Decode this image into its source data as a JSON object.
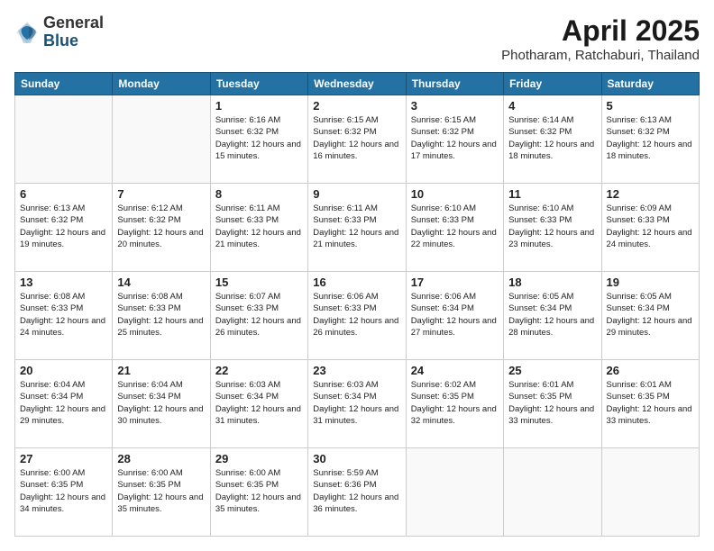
{
  "logo": {
    "general": "General",
    "blue": "Blue"
  },
  "title": {
    "month": "April 2025",
    "location": "Photharam, Ratchaburi, Thailand"
  },
  "weekdays": [
    "Sunday",
    "Monday",
    "Tuesday",
    "Wednesday",
    "Thursday",
    "Friday",
    "Saturday"
  ],
  "weeks": [
    [
      {
        "day": "",
        "info": ""
      },
      {
        "day": "",
        "info": ""
      },
      {
        "day": "1",
        "info": "Sunrise: 6:16 AM\nSunset: 6:32 PM\nDaylight: 12 hours\nand 15 minutes."
      },
      {
        "day": "2",
        "info": "Sunrise: 6:15 AM\nSunset: 6:32 PM\nDaylight: 12 hours\nand 16 minutes."
      },
      {
        "day": "3",
        "info": "Sunrise: 6:15 AM\nSunset: 6:32 PM\nDaylight: 12 hours\nand 17 minutes."
      },
      {
        "day": "4",
        "info": "Sunrise: 6:14 AM\nSunset: 6:32 PM\nDaylight: 12 hours\nand 18 minutes."
      },
      {
        "day": "5",
        "info": "Sunrise: 6:13 AM\nSunset: 6:32 PM\nDaylight: 12 hours\nand 18 minutes."
      }
    ],
    [
      {
        "day": "6",
        "info": "Sunrise: 6:13 AM\nSunset: 6:32 PM\nDaylight: 12 hours\nand 19 minutes."
      },
      {
        "day": "7",
        "info": "Sunrise: 6:12 AM\nSunset: 6:32 PM\nDaylight: 12 hours\nand 20 minutes."
      },
      {
        "day": "8",
        "info": "Sunrise: 6:11 AM\nSunset: 6:33 PM\nDaylight: 12 hours\nand 21 minutes."
      },
      {
        "day": "9",
        "info": "Sunrise: 6:11 AM\nSunset: 6:33 PM\nDaylight: 12 hours\nand 21 minutes."
      },
      {
        "day": "10",
        "info": "Sunrise: 6:10 AM\nSunset: 6:33 PM\nDaylight: 12 hours\nand 22 minutes."
      },
      {
        "day": "11",
        "info": "Sunrise: 6:10 AM\nSunset: 6:33 PM\nDaylight: 12 hours\nand 23 minutes."
      },
      {
        "day": "12",
        "info": "Sunrise: 6:09 AM\nSunset: 6:33 PM\nDaylight: 12 hours\nand 24 minutes."
      }
    ],
    [
      {
        "day": "13",
        "info": "Sunrise: 6:08 AM\nSunset: 6:33 PM\nDaylight: 12 hours\nand 24 minutes."
      },
      {
        "day": "14",
        "info": "Sunrise: 6:08 AM\nSunset: 6:33 PM\nDaylight: 12 hours\nand 25 minutes."
      },
      {
        "day": "15",
        "info": "Sunrise: 6:07 AM\nSunset: 6:33 PM\nDaylight: 12 hours\nand 26 minutes."
      },
      {
        "day": "16",
        "info": "Sunrise: 6:06 AM\nSunset: 6:33 PM\nDaylight: 12 hours\nand 26 minutes."
      },
      {
        "day": "17",
        "info": "Sunrise: 6:06 AM\nSunset: 6:34 PM\nDaylight: 12 hours\nand 27 minutes."
      },
      {
        "day": "18",
        "info": "Sunrise: 6:05 AM\nSunset: 6:34 PM\nDaylight: 12 hours\nand 28 minutes."
      },
      {
        "day": "19",
        "info": "Sunrise: 6:05 AM\nSunset: 6:34 PM\nDaylight: 12 hours\nand 29 minutes."
      }
    ],
    [
      {
        "day": "20",
        "info": "Sunrise: 6:04 AM\nSunset: 6:34 PM\nDaylight: 12 hours\nand 29 minutes."
      },
      {
        "day": "21",
        "info": "Sunrise: 6:04 AM\nSunset: 6:34 PM\nDaylight: 12 hours\nand 30 minutes."
      },
      {
        "day": "22",
        "info": "Sunrise: 6:03 AM\nSunset: 6:34 PM\nDaylight: 12 hours\nand 31 minutes."
      },
      {
        "day": "23",
        "info": "Sunrise: 6:03 AM\nSunset: 6:34 PM\nDaylight: 12 hours\nand 31 minutes."
      },
      {
        "day": "24",
        "info": "Sunrise: 6:02 AM\nSunset: 6:35 PM\nDaylight: 12 hours\nand 32 minutes."
      },
      {
        "day": "25",
        "info": "Sunrise: 6:01 AM\nSunset: 6:35 PM\nDaylight: 12 hours\nand 33 minutes."
      },
      {
        "day": "26",
        "info": "Sunrise: 6:01 AM\nSunset: 6:35 PM\nDaylight: 12 hours\nand 33 minutes."
      }
    ],
    [
      {
        "day": "27",
        "info": "Sunrise: 6:00 AM\nSunset: 6:35 PM\nDaylight: 12 hours\nand 34 minutes."
      },
      {
        "day": "28",
        "info": "Sunrise: 6:00 AM\nSunset: 6:35 PM\nDaylight: 12 hours\nand 35 minutes."
      },
      {
        "day": "29",
        "info": "Sunrise: 6:00 AM\nSunset: 6:35 PM\nDaylight: 12 hours\nand 35 minutes."
      },
      {
        "day": "30",
        "info": "Sunrise: 5:59 AM\nSunset: 6:36 PM\nDaylight: 12 hours\nand 36 minutes."
      },
      {
        "day": "",
        "info": ""
      },
      {
        "day": "",
        "info": ""
      },
      {
        "day": "",
        "info": ""
      }
    ]
  ]
}
